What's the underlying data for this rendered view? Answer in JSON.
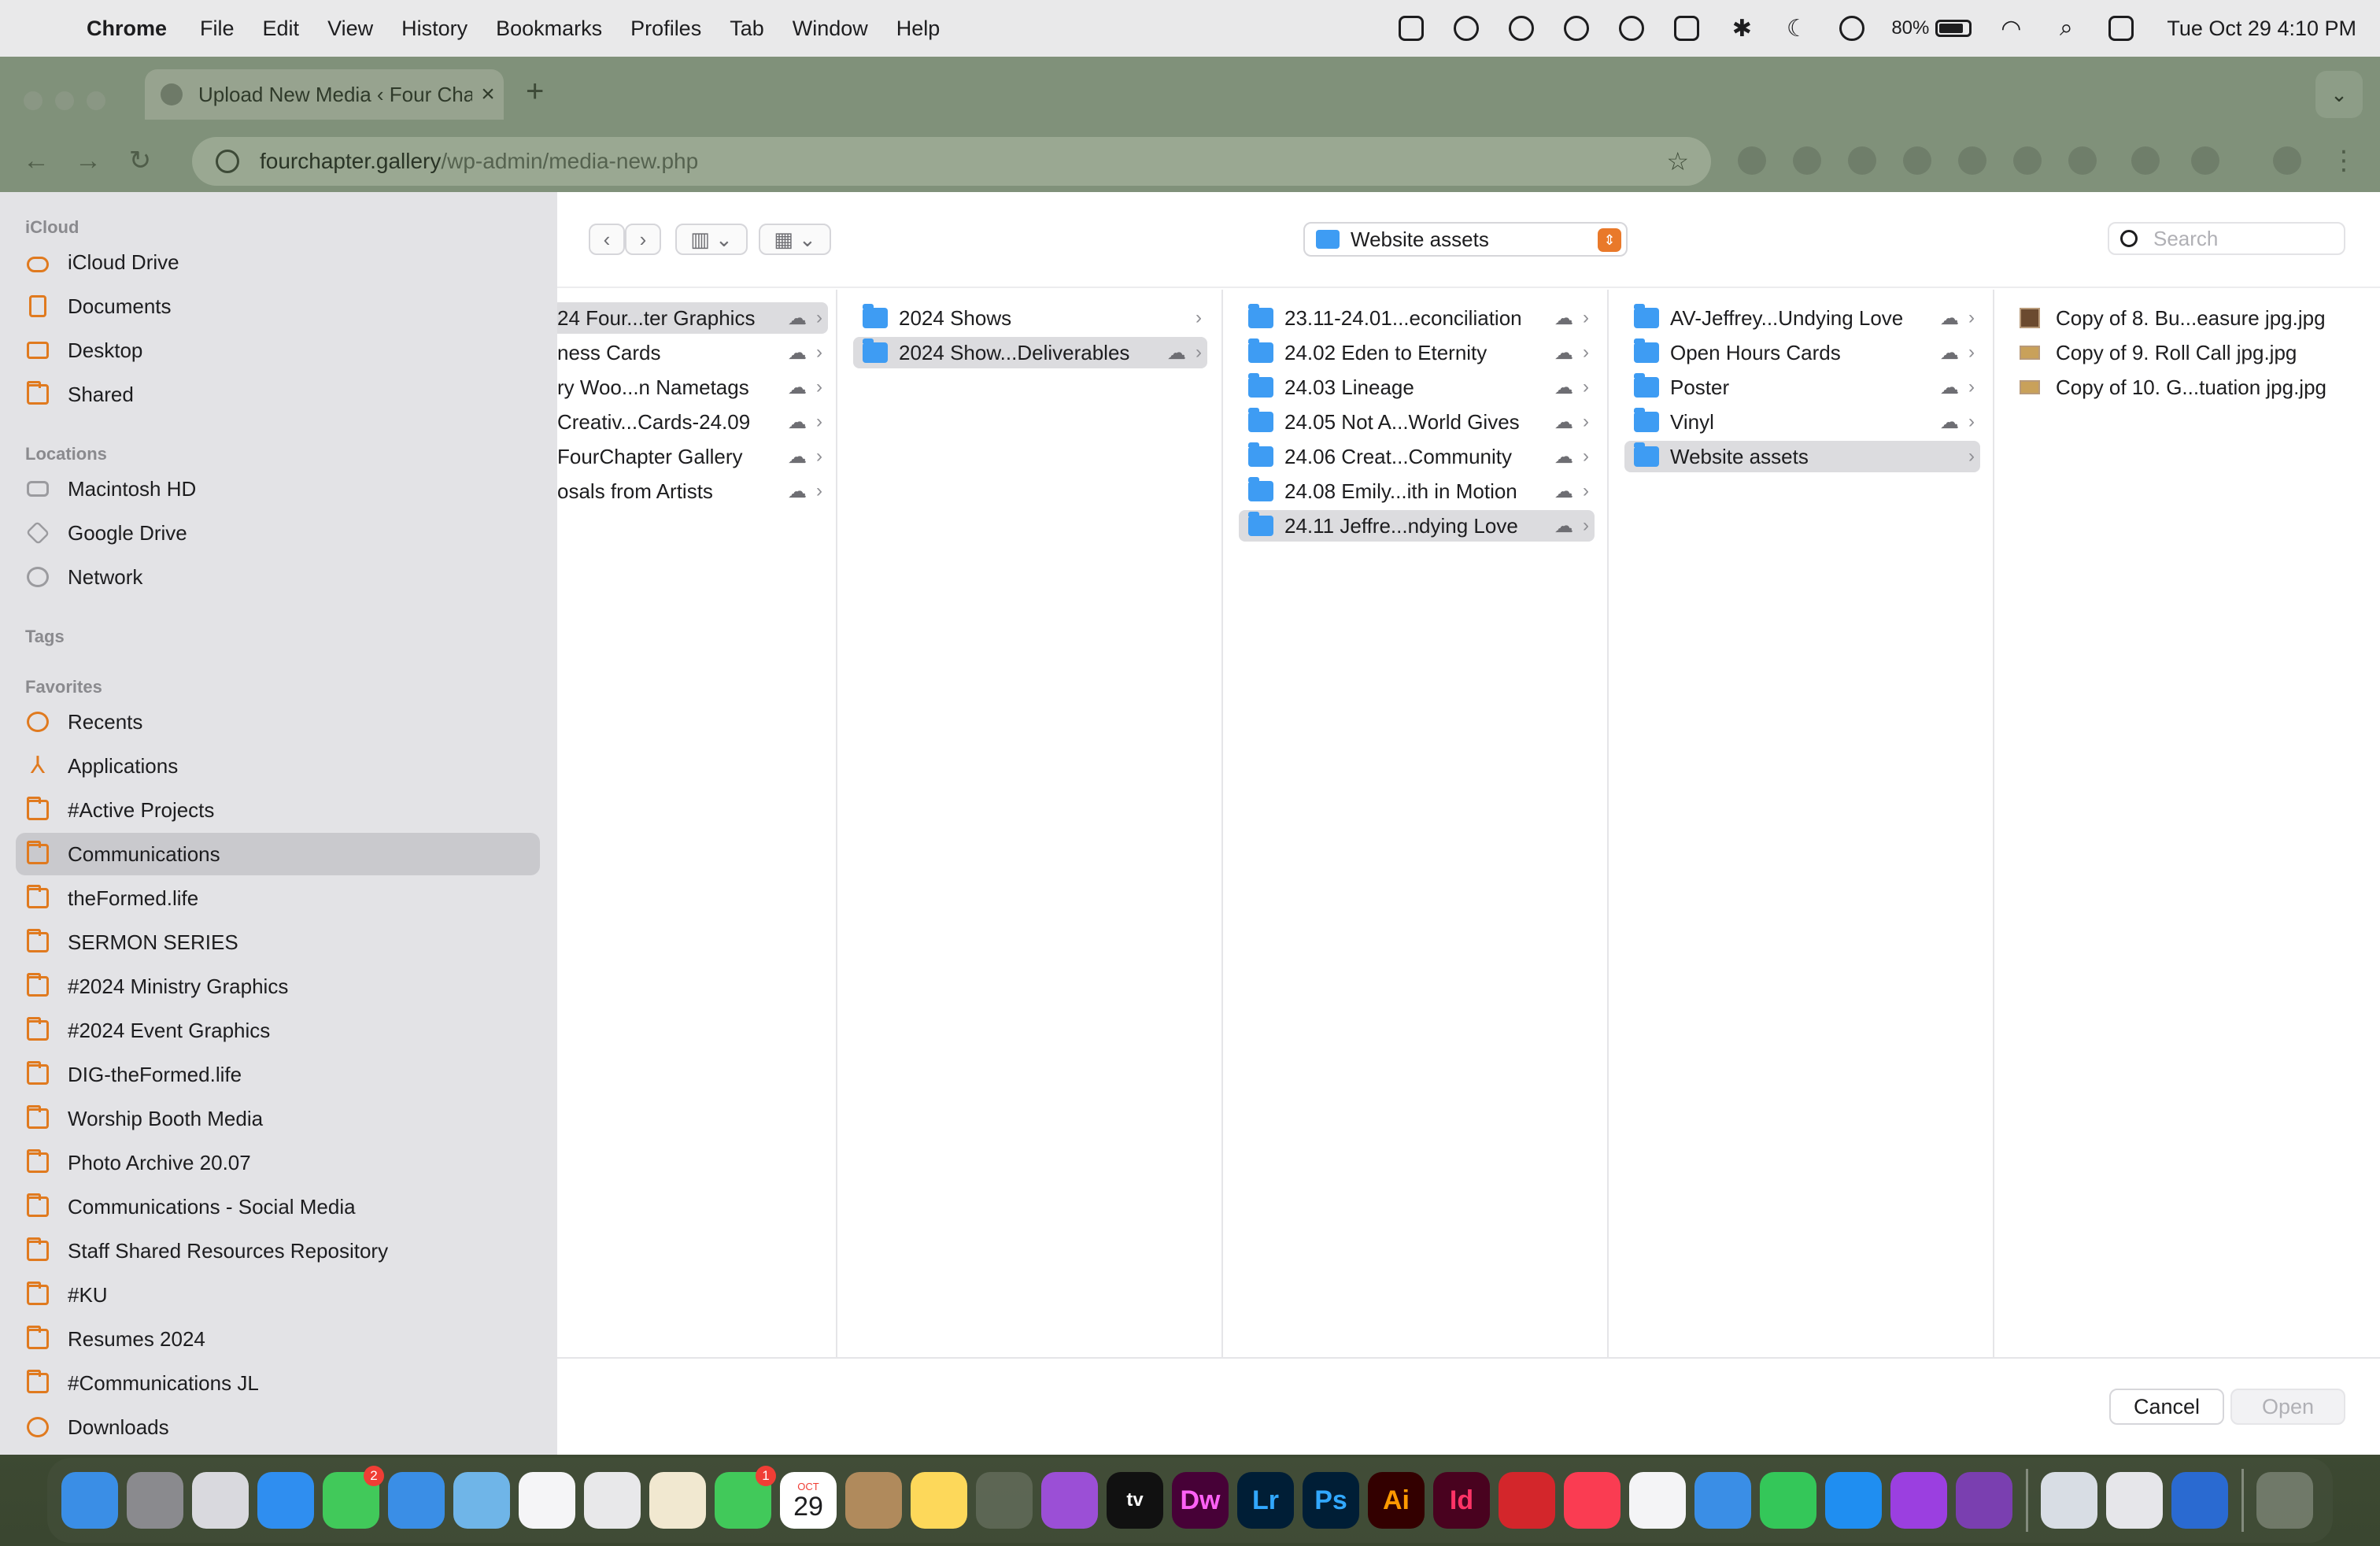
{
  "menubar": {
    "app": "Chrome",
    "menus": [
      "File",
      "Edit",
      "View",
      "History",
      "Bookmarks",
      "Profiles",
      "Tab",
      "Window",
      "Help"
    ],
    "battery": "80%",
    "clock": "Tue Oct 29  4:10 PM"
  },
  "browser": {
    "tab_title": "Upload New Media ‹ Four Chapter",
    "url_host": "fourchapter.gallery",
    "url_path": "/wp-admin/media-new.php"
  },
  "sidebar": {
    "sections": {
      "icloud": "iCloud",
      "locations": "Locations",
      "tags": "Tags",
      "favorites": "Favorites"
    },
    "icloud": [
      "iCloud Drive",
      "Documents",
      "Desktop",
      "Shared"
    ],
    "locations": [
      "Macintosh HD",
      "Google Drive",
      "Network"
    ],
    "favorites": [
      "Recents",
      "Applications",
      "#Active Projects",
      "Communications",
      "theFormed.life",
      "SERMON SERIES",
      "#2024 Ministry Graphics",
      "#2024 Event Graphics",
      "DIG-theFormed.life",
      "Worship Booth Media",
      "Photo Archive 20.07",
      "Communications - Social Media",
      "Staff Shared Resources Repository",
      "#KU",
      "Resumes 2024",
      "#Communications JL",
      "Downloads"
    ],
    "selected": "Communications"
  },
  "toolbar": {
    "current_folder": "Website assets",
    "search_placeholder": "Search"
  },
  "columns": {
    "col1": [
      "24 Four...ter Graphics",
      "ness Cards",
      "ry Woo...n Nametags",
      "Creativ...Cards-24.09",
      "FourChapter Gallery",
      "osals from Artists"
    ],
    "col2": [
      "2024 Shows",
      "2024 Show...Deliverables"
    ],
    "col3": [
      "23.11-24.01...econciliation",
      "24.02 Eden to Eternity",
      "24.03 Lineage",
      "24.05 Not A...World Gives",
      "24.06 Creat...Community",
      "24.08 Emily...ith in Motion",
      "24.11 Jeffre...ndying Love"
    ],
    "col4": [
      "AV-Jeffrey...Undying Love",
      "Open Hours Cards",
      "Poster",
      "Vinyl",
      "Website assets"
    ],
    "col5": [
      "Copy of 8. Bu...easure jpg.jpg",
      "Copy of 9. Roll Call jpg.jpg",
      "Copy of 10. G...tuation jpg.jpg"
    ]
  },
  "buttons": {
    "cancel": "Cancel",
    "open": "Open"
  },
  "dock": {
    "badges": {
      "messages": "2",
      "facetime": "1"
    },
    "calendar_month": "OCT",
    "calendar_day": "29",
    "labels": {
      "tv": "tv",
      "dw": "Dw",
      "lr": "Lr",
      "ps": "Ps",
      "ai": "Ai",
      "id": "Id"
    }
  }
}
